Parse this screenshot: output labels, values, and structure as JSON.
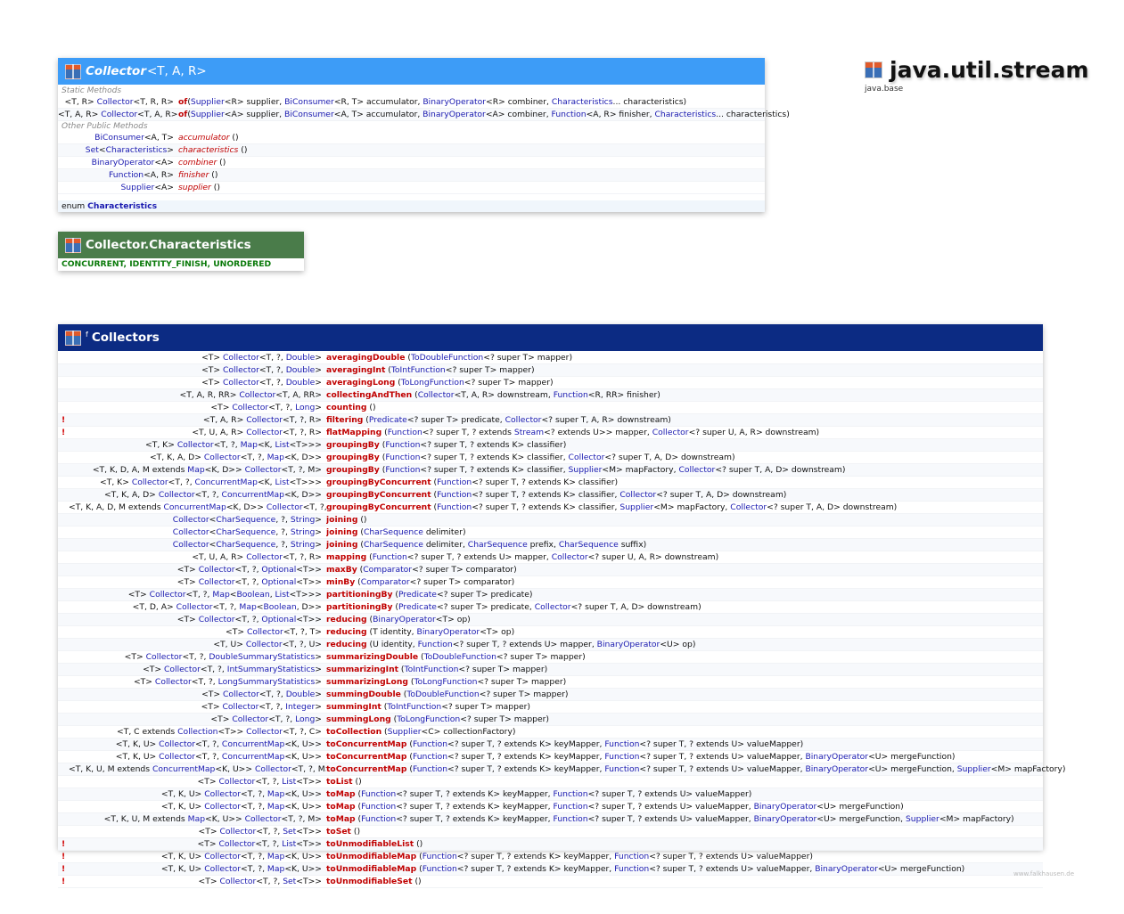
{
  "package": {
    "name": "java.util.stream",
    "module": "java.base"
  },
  "footer": "www.falkhausen.de",
  "collector": {
    "title": "Collector",
    "type_params": "<T, A, R>",
    "header_color": "#3d9cf7",
    "static_label": "Static Methods",
    "static_methods": [
      {
        "ret": "<T, R> Collector<T, R, R>",
        "name": "of",
        "params": "(Supplier<R> supplier, BiConsumer<R, T> accumulator, BinaryOperator<R> combiner, Characteristics... characteristics)"
      },
      {
        "ret": "<T, A, R> Collector<T, A, R>",
        "name": "of",
        "params": "(Supplier<A> supplier, BiConsumer<A, T> accumulator, BinaryOperator<A> combiner, Function<A, R> finisher, Characteristics... characteristics)"
      }
    ],
    "public_label": "Other Public Methods",
    "public_methods": [
      {
        "ret": "BiConsumer<A, T>",
        "name": "accumulator",
        "params": " ()"
      },
      {
        "ret": "Set<Characteristics>",
        "name": "characteristics",
        "params": " ()"
      },
      {
        "ret": "BinaryOperator<A>",
        "name": "combiner",
        "params": " ()"
      },
      {
        "ret": "Function<A, R>",
        "name": "finisher",
        "params": " ()"
      },
      {
        "ret": "Supplier<A>",
        "name": "supplier",
        "params": " ()"
      }
    ],
    "enum_label": "enum",
    "enum_name": "Characteristics"
  },
  "characteristics": {
    "title": "Collector.Characteristics",
    "header_color": "#4a7c4a",
    "values": "CONCURRENT, IDENTITY_FINISH, UNORDERED"
  },
  "collectors": {
    "title": "Collectors",
    "modifier": "f",
    "header_color": "#0c2b83",
    "methods": [
      {
        "warn": "",
        "ret": "<T> Collector<T, ?, Double>",
        "name": "averagingDouble",
        "params": " (ToDoubleFunction<? super T> mapper)"
      },
      {
        "warn": "",
        "ret": "<T> Collector<T, ?, Double>",
        "name": "averagingInt",
        "params": " (ToIntFunction<? super T> mapper)"
      },
      {
        "warn": "",
        "ret": "<T> Collector<T, ?, Double>",
        "name": "averagingLong",
        "params": " (ToLongFunction<? super T> mapper)"
      },
      {
        "warn": "",
        "ret": "<T, A, R, RR> Collector<T, A, RR>",
        "name": "collectingAndThen",
        "params": " (Collector<T, A, R> downstream, Function<R, RR> finisher)"
      },
      {
        "warn": "",
        "ret": "<T> Collector<T, ?, Long>",
        "name": "counting",
        "params": " ()"
      },
      {
        "warn": "!",
        "ret": "<T, A, R> Collector<T, ?, R>",
        "name": "filtering",
        "params": " (Predicate<? super T> predicate, Collector<? super T, A, R> downstream)"
      },
      {
        "warn": "!",
        "ret": "<T, U, A, R> Collector<T, ?, R>",
        "name": "flatMapping",
        "params": " (Function<? super T, ? extends Stream<? extends U>> mapper, Collector<? super U, A, R> downstream)"
      },
      {
        "warn": "",
        "ret": "<T, K> Collector<T, ?, Map<K, List<T>>>",
        "name": "groupingBy",
        "params": " (Function<? super T, ? extends K> classifier)"
      },
      {
        "warn": "",
        "ret": "<T, K, A, D> Collector<T, ?, Map<K, D>>",
        "name": "groupingBy",
        "params": " (Function<? super T, ? extends K> classifier, Collector<? super T, A, D> downstream)"
      },
      {
        "warn": "",
        "ret": "<T, K, D, A, M extends Map<K, D>> Collector<T, ?, M>",
        "name": "groupingBy",
        "params": " (Function<? super T, ? extends K> classifier, Supplier<M> mapFactory, Collector<? super T, A, D> downstream)"
      },
      {
        "warn": "",
        "ret": "<T, K> Collector<T, ?, ConcurrentMap<K, List<T>>>",
        "name": "groupingByConcurrent",
        "params": " (Function<? super T, ? extends K> classifier)"
      },
      {
        "warn": "",
        "ret": "<T, K, A, D> Collector<T, ?, ConcurrentMap<K, D>>",
        "name": "groupingByConcurrent",
        "params": " (Function<? super T, ? extends K> classifier, Collector<? super T, A, D> downstream)"
      },
      {
        "warn": "",
        "ret": "<T, K, A, D, M extends ConcurrentMap<K, D>> Collector<T, ?, M>",
        "name": "groupingByConcurrent",
        "params": " (Function<? super T, ? extends K> classifier, Supplier<M> mapFactory, Collector<? super T, A, D> downstream)"
      },
      {
        "warn": "",
        "ret": "Collector<CharSequence, ?, String>",
        "name": "joining",
        "params": " ()"
      },
      {
        "warn": "",
        "ret": "Collector<CharSequence, ?, String>",
        "name": "joining",
        "params": " (CharSequence delimiter)"
      },
      {
        "warn": "",
        "ret": "Collector<CharSequence, ?, String>",
        "name": "joining",
        "params": " (CharSequence delimiter, CharSequence prefix, CharSequence suffix)"
      },
      {
        "warn": "",
        "ret": "<T, U, A, R> Collector<T, ?, R>",
        "name": "mapping",
        "params": " (Function<? super T, ? extends U> mapper, Collector<? super U, A, R> downstream)"
      },
      {
        "warn": "",
        "ret": "<T> Collector<T, ?, Optional<T>>",
        "name": "maxBy",
        "params": " (Comparator<? super T> comparator)"
      },
      {
        "warn": "",
        "ret": "<T> Collector<T, ?, Optional<T>>",
        "name": "minBy",
        "params": " (Comparator<? super T> comparator)"
      },
      {
        "warn": "",
        "ret": "<T> Collector<T, ?, Map<Boolean, List<T>>>",
        "name": "partitioningBy",
        "params": " (Predicate<? super T> predicate)"
      },
      {
        "warn": "",
        "ret": "<T, D, A> Collector<T, ?, Map<Boolean, D>>",
        "name": "partitioningBy",
        "params": " (Predicate<? super T> predicate, Collector<? super T, A, D> downstream)"
      },
      {
        "warn": "",
        "ret": "<T> Collector<T, ?, Optional<T>>",
        "name": "reducing",
        "params": " (BinaryOperator<T> op)"
      },
      {
        "warn": "",
        "ret": "<T> Collector<T, ?, T>",
        "name": "reducing",
        "params": " (T identity, BinaryOperator<T> op)"
      },
      {
        "warn": "",
        "ret": "<T, U> Collector<T, ?, U>",
        "name": "reducing",
        "params": " (U identity, Function<? super T, ? extends U> mapper, BinaryOperator<U> op)"
      },
      {
        "warn": "",
        "ret": "<T> Collector<T, ?, DoubleSummaryStatistics>",
        "name": "summarizingDouble",
        "params": " (ToDoubleFunction<? super T> mapper)"
      },
      {
        "warn": "",
        "ret": "<T> Collector<T, ?, IntSummaryStatistics>",
        "name": "summarizingInt",
        "params": " (ToIntFunction<? super T> mapper)"
      },
      {
        "warn": "",
        "ret": "<T> Collector<T, ?, LongSummaryStatistics>",
        "name": "summarizingLong",
        "params": " (ToLongFunction<? super T> mapper)"
      },
      {
        "warn": "",
        "ret": "<T> Collector<T, ?, Double>",
        "name": "summingDouble",
        "params": " (ToDoubleFunction<? super T> mapper)"
      },
      {
        "warn": "",
        "ret": "<T> Collector<T, ?, Integer>",
        "name": "summingInt",
        "params": " (ToIntFunction<? super T> mapper)"
      },
      {
        "warn": "",
        "ret": "<T> Collector<T, ?, Long>",
        "name": "summingLong",
        "params": " (ToLongFunction<? super T> mapper)"
      },
      {
        "warn": "",
        "ret": "<T, C extends Collection<T>> Collector<T, ?, C>",
        "name": "toCollection",
        "params": " (Supplier<C> collectionFactory)"
      },
      {
        "warn": "",
        "ret": "<T, K, U> Collector<T, ?, ConcurrentMap<K, U>>",
        "name": "toConcurrentMap",
        "params": " (Function<? super T, ? extends K> keyMapper, Function<? super T, ? extends U> valueMapper)"
      },
      {
        "warn": "",
        "ret": "<T, K, U> Collector<T, ?, ConcurrentMap<K, U>>",
        "name": "toConcurrentMap",
        "params": " (Function<? super T, ? extends K> keyMapper, Function<? super T, ? extends U> valueMapper, BinaryOperator<U> mergeFunction)"
      },
      {
        "warn": "",
        "ret": "<T, K, U, M extends ConcurrentMap<K, U>> Collector<T, ?, M>",
        "name": "toConcurrentMap",
        "params": " (Function<? super T, ? extends K> keyMapper, Function<? super T, ? extends U> valueMapper, BinaryOperator<U> mergeFunction, Supplier<M> mapFactory)"
      },
      {
        "warn": "",
        "ret": "<T> Collector<T, ?, List<T>>",
        "name": "toList",
        "params": " ()"
      },
      {
        "warn": "",
        "ret": "<T, K, U> Collector<T, ?, Map<K, U>>",
        "name": "toMap",
        "params": " (Function<? super T, ? extends K> keyMapper, Function<? super T, ? extends U> valueMapper)"
      },
      {
        "warn": "",
        "ret": "<T, K, U> Collector<T, ?, Map<K, U>>",
        "name": "toMap",
        "params": " (Function<? super T, ? extends K> keyMapper, Function<? super T, ? extends U> valueMapper, BinaryOperator<U> mergeFunction)"
      },
      {
        "warn": "",
        "ret": "<T, K, U, M extends Map<K, U>> Collector<T, ?, M>",
        "name": "toMap",
        "params": " (Function<? super T, ? extends K> keyMapper, Function<? super T, ? extends U> valueMapper, BinaryOperator<U> mergeFunction, Supplier<M> mapFactory)"
      },
      {
        "warn": "",
        "ret": "<T> Collector<T, ?, Set<T>>",
        "name": "toSet",
        "params": " ()"
      },
      {
        "warn": "!",
        "ret": "<T> Collector<T, ?, List<T>>",
        "name": "toUnmodifiableList",
        "params": " ()"
      },
      {
        "warn": "!",
        "ret": "<T, K, U> Collector<T, ?, Map<K, U>>",
        "name": "toUnmodifiableMap",
        "params": " (Function<? super T, ? extends K> keyMapper, Function<? super T, ? extends U> valueMapper)"
      },
      {
        "warn": "!",
        "ret": "<T, K, U> Collector<T, ?, Map<K, U>>",
        "name": "toUnmodifiableMap",
        "params": " (Function<? super T, ? extends K> keyMapper, Function<? super T, ? extends U> valueMapper, BinaryOperator<U> mergeFunction)"
      },
      {
        "warn": "!",
        "ret": "<T> Collector<T, ?, Set<T>>",
        "name": "toUnmodifiableSet",
        "params": " ()"
      }
    ]
  }
}
